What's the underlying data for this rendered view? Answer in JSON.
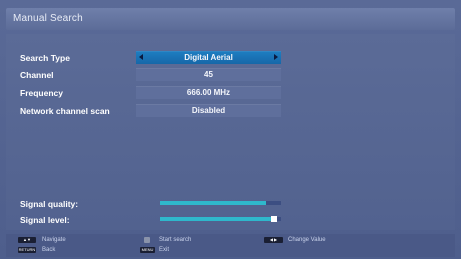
{
  "title": "Manual Search",
  "rows": [
    {
      "label": "Search Type",
      "value": "Digital Aerial"
    },
    {
      "label": "Channel",
      "value": "45"
    },
    {
      "label": "Frequency",
      "value": "666.00 MHz"
    },
    {
      "label": "Network channel scan",
      "value": "Disabled"
    }
  ],
  "signal": {
    "quality_label": "Signal quality:",
    "quality_level": 0.88,
    "level_label": "Signal level:",
    "level_level": 0.92
  },
  "footer": {
    "navigate": "Navigate",
    "back": "Back",
    "start_search": "Start search",
    "exit": "Exit",
    "change_value": "Change Value",
    "back_key": "RETURN",
    "menu_key": "MENU"
  },
  "colors": {
    "background": "#5a6a97",
    "selected": "#1e7ec2",
    "signal_bar": "#2fb8cc"
  }
}
